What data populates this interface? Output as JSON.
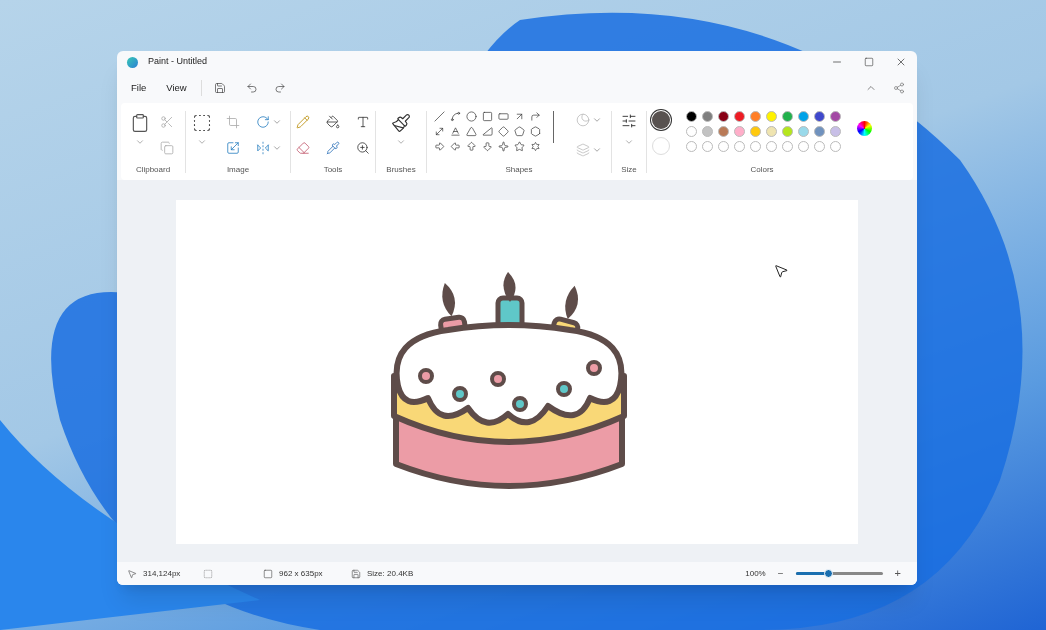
{
  "window": {
    "title": "Paint - Untitled"
  },
  "menu": [
    {
      "label": "File"
    },
    {
      "label": "View"
    }
  ],
  "ribbon": {
    "groups": [
      {
        "kind": "clipboard",
        "label": "Clipboard"
      },
      {
        "kind": "image",
        "label": "Image"
      },
      {
        "kind": "tools",
        "label": "Tools"
      },
      {
        "kind": "brushes",
        "label": "Brushes"
      },
      {
        "kind": "shapes",
        "label": "Shapes"
      },
      {
        "kind": "size",
        "label": "Size"
      },
      {
        "kind": "colors",
        "label": "Colors"
      }
    ]
  },
  "colors": {
    "primary": {
      "color": "#585250",
      "selected": true
    },
    "secondary": {
      "color": "#ffffff",
      "selected": false
    },
    "palette": [
      {
        "color": "#000000"
      },
      {
        "color": "#7f7f7f"
      },
      {
        "color": "#880015"
      },
      {
        "color": "#ed1c24"
      },
      {
        "color": "#ff7f27"
      },
      {
        "color": "#fff200"
      },
      {
        "color": "#22b14c"
      },
      {
        "color": "#00a2e8"
      },
      {
        "color": "#3f48cc"
      },
      {
        "color": "#a349a4"
      },
      {
        "color": "#ffffff"
      },
      {
        "color": "#c3c3c3"
      },
      {
        "color": "#b97a57"
      },
      {
        "color": "#ffaec9"
      },
      {
        "color": "#ffc90e"
      },
      {
        "color": "#efe4b0"
      },
      {
        "color": "#b5e61d"
      },
      {
        "color": "#99d9ea"
      },
      {
        "color": "#7092be"
      },
      {
        "color": "#c8bfe7"
      }
    ]
  },
  "status_bar": {
    "cursor": "314,124px",
    "canvas_size": "962 x 635px",
    "file_size": "Size: 20.4KB",
    "zoom": "100%",
    "zoom_out": "−",
    "zoom_in": "+"
  },
  "zoom_slider": {
    "level": 0.37
  }
}
